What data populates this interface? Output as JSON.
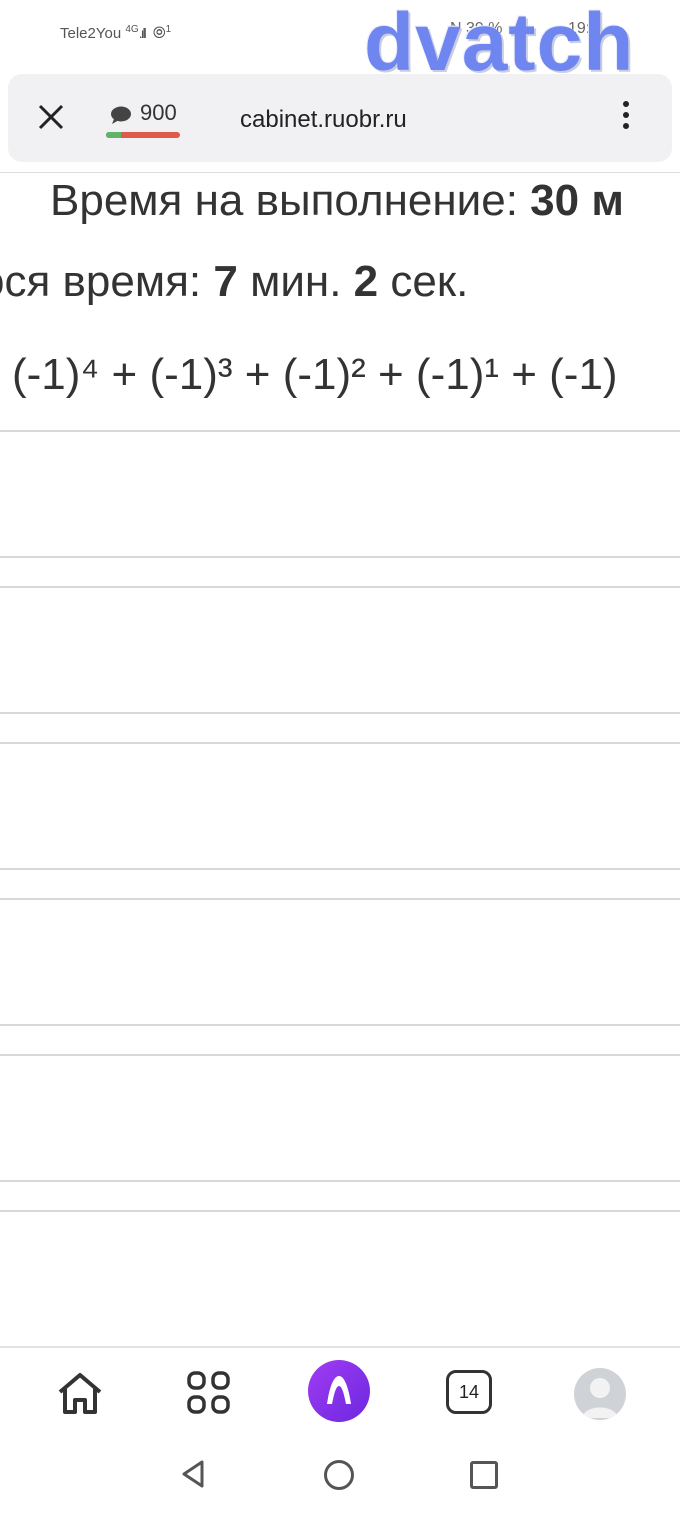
{
  "status_bar": {
    "carrier": "Tele2You",
    "network": "4G",
    "hotspot_count": "1",
    "battery": "39 %",
    "time": "19:1"
  },
  "watermark": "dvatch",
  "address_bar": {
    "comment_count": "900",
    "comment_ratio": 0.2,
    "url": "cabinet.ruobr.ru"
  },
  "content": {
    "time_label": "Время на выполнение: ",
    "time_value": "30 м",
    "remaining_prefix": "ося время: ",
    "remaining_minutes": "7",
    "remaining_min_unit": " мин. ",
    "remaining_seconds": "2",
    "remaining_sec_unit": " сек.",
    "expression": "(-1)⁴ + (-1)³ + (-1)² + (-1)¹ + (-1)"
  },
  "bottom_nav": {
    "tabs_count": "14"
  },
  "colors": {
    "accent": "#7b2ff0",
    "progress_good": "#5fb36a",
    "progress_bad": "#e05a4a"
  }
}
